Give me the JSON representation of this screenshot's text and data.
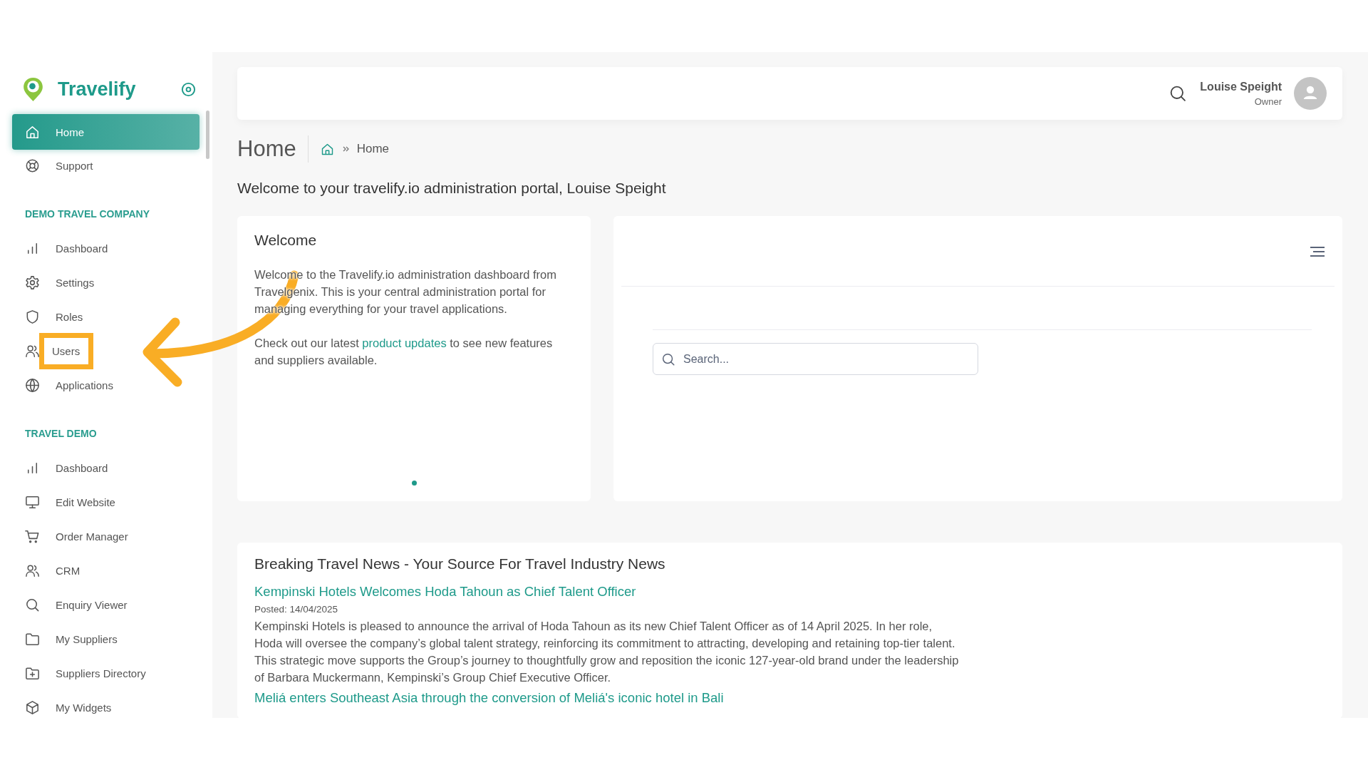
{
  "brand": {
    "name": "Travelify"
  },
  "sidebar": {
    "items": [
      {
        "label": "Home",
        "kind": "home",
        "selected": true,
        "highlighted": false
      },
      {
        "label": "Support",
        "kind": "lifebuoy",
        "selected": false,
        "highlighted": false
      }
    ],
    "sections": [
      {
        "title": "DEMO TRAVEL COMPANY",
        "items": [
          {
            "label": "Dashboard",
            "kind": "chart",
            "selected": false,
            "highlighted": false
          },
          {
            "label": "Settings",
            "kind": "gear",
            "selected": false,
            "highlighted": false
          },
          {
            "label": "Roles",
            "kind": "shield",
            "selected": false,
            "highlighted": false
          },
          {
            "label": "Users",
            "kind": "users",
            "selected": false,
            "highlighted": true
          },
          {
            "label": "Applications",
            "kind": "globe",
            "selected": false,
            "highlighted": false
          }
        ]
      },
      {
        "title": "TRAVEL DEMO",
        "items": [
          {
            "label": "Dashboard",
            "kind": "chart",
            "selected": false,
            "highlighted": false
          },
          {
            "label": "Edit Website",
            "kind": "monitor",
            "selected": false,
            "highlighted": false
          },
          {
            "label": "Order Manager",
            "kind": "cart",
            "selected": false,
            "highlighted": false
          },
          {
            "label": "CRM",
            "kind": "users",
            "selected": false,
            "highlighted": false
          },
          {
            "label": "Enquiry Viewer",
            "kind": "search",
            "selected": false,
            "highlighted": false
          },
          {
            "label": "My Suppliers",
            "kind": "folder",
            "selected": false,
            "highlighted": false
          },
          {
            "label": "Suppliers Directory",
            "kind": "folder-plus",
            "selected": false,
            "highlighted": false
          },
          {
            "label": "My Widgets",
            "kind": "cube",
            "selected": false,
            "highlighted": false
          }
        ]
      }
    ]
  },
  "header": {
    "user_name": "Louise Speight",
    "user_role": "Owner"
  },
  "page": {
    "title": "Home",
    "breadcrumb": [
      "Home"
    ],
    "welcome_line": "Welcome to your travelify.io administration portal, Louise Speight"
  },
  "welcome_card": {
    "title": "Welcome",
    "paragraph": "Welcome to the Travelify.io administration dashboard from Travelgenix. This is your central administration portal for managing everything for your travel applications.",
    "updates": {
      "before": "Check out our latest ",
      "link": "product updates",
      "after": " to see new features and suppliers available."
    },
    "dots": [
      {
        "selected": true
      }
    ]
  },
  "search": {
    "placeholder": "Search..."
  },
  "news": {
    "title": "Breaking Travel News - Your Source For Travel Industry News",
    "articles": [
      {
        "headline": "Kempinski Hotels Welcomes Hoda Tahoun as Chief Talent Officer",
        "posted": "Posted: 14/04/2025",
        "summary": "Kempinski Hotels is pleased to announce the arrival of Hoda Tahoun as its new Chief Talent Officer as of 14 April 2025. In her role, Hoda will oversee the company’s global talent strategy, reinforcing its commitment to attracting, developing and retaining top-tier talent. This strategic move supports the Group’s journey to thoughtfully grow and reposition the iconic 127-year-old brand under the leadership of Barbara Muckermann, Kempinski’s Group Chief Executive Officer."
      },
      {
        "headline": "Meliá enters Southeast Asia through the conversion of Meliá's iconic hotel in Bali"
      }
    ]
  },
  "annotation": {
    "kind": "arrow"
  }
}
